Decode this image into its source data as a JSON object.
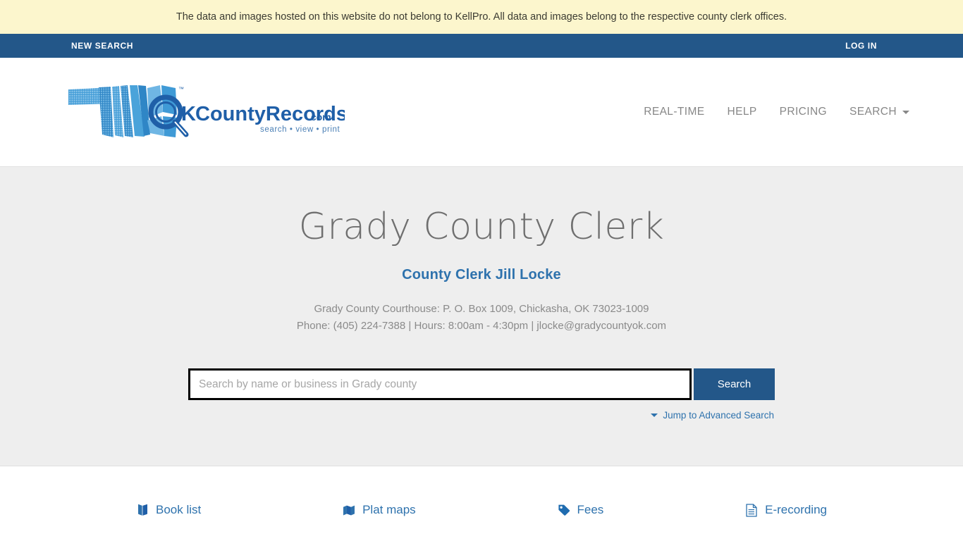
{
  "disclaimer": {
    "text": "The data and images hosted on this website do not belong to KellPro. All data and images belong to the respective county clerk offices."
  },
  "topbar": {
    "new_search_label": "NEW SEARCH",
    "login_label": "LOG IN"
  },
  "logo": {
    "brand_ok": "OK",
    "brand_rest": "CountyRecords",
    "brand_tld": ".com",
    "tagline": "search • view • print",
    "trademark": "™"
  },
  "mainnav": {
    "items": [
      {
        "label": "REAL-TIME",
        "icon": ""
      },
      {
        "label": "HELP",
        "icon": ""
      },
      {
        "label": "PRICING",
        "icon": ""
      },
      {
        "label": "SEARCH",
        "icon": "chevron-down-icon"
      }
    ]
  },
  "hero": {
    "title": "Grady County Clerk",
    "clerk": "County Clerk Jill Locke",
    "address_line": "Grady County Courthouse: P. O. Box 1009, Chickasha, OK 73023-1009",
    "contact_line": "Phone: (405) 224-7388 | Hours: 8:00am - 4:30pm | jlocke@gradycountyok.com"
  },
  "search": {
    "placeholder": "Search by name or business in Grady county",
    "value": "",
    "button_label": "Search",
    "advanced_label": "Jump to Advanced Search"
  },
  "quicklinks": {
    "items": [
      {
        "label": "Book list",
        "icon": "book-icon"
      },
      {
        "label": "Plat maps",
        "icon": "map-icon"
      },
      {
        "label": "Fees",
        "icon": "tag-icon"
      },
      {
        "label": "E-recording",
        "icon": "document-icon"
      }
    ]
  },
  "colors": {
    "banner_yellow": "#fcf6cd",
    "nav_blue": "#235789",
    "link_blue": "#2e72ad",
    "hero_gray": "#eeeeee",
    "title_gray": "#6f6f6f",
    "logo_light_blue": "#3f9ad6",
    "logo_dark_blue": "#1f5fa8"
  }
}
